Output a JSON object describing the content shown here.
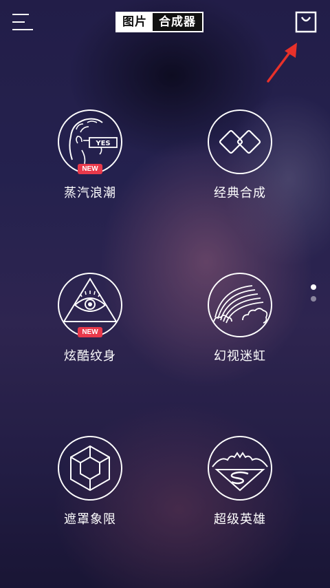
{
  "header": {
    "logo_left": "图片",
    "logo_right": "合成器",
    "menu_icon": "hamburger-menu-icon",
    "bag_icon": "shopping-bag-icon"
  },
  "annotation": {
    "arrow_color": "#e8312a"
  },
  "colors": {
    "badge_bg": "#e9394b",
    "logo_dark": "#111111",
    "text": "#ffffff"
  },
  "grid": {
    "items": [
      {
        "label": "蒸汽浪潮",
        "icon": "vaporwave-head-yes-icon",
        "badge": "NEW",
        "yes_text": "YES"
      },
      {
        "label": "经典合成",
        "icon": "overlapping-diamonds-icon",
        "badge": ""
      },
      {
        "label": "炫酷纹身",
        "icon": "eye-triangle-icon",
        "badge": "NEW"
      },
      {
        "label": "幻视迷虹",
        "icon": "rainbow-clouds-icon",
        "badge": ""
      },
      {
        "label": "遮罩象限",
        "icon": "cube-icon",
        "badge": ""
      },
      {
        "label": "超级英雄",
        "icon": "superman-bat-icon",
        "badge": ""
      }
    ]
  },
  "pager": {
    "total": 2,
    "current": 1
  }
}
